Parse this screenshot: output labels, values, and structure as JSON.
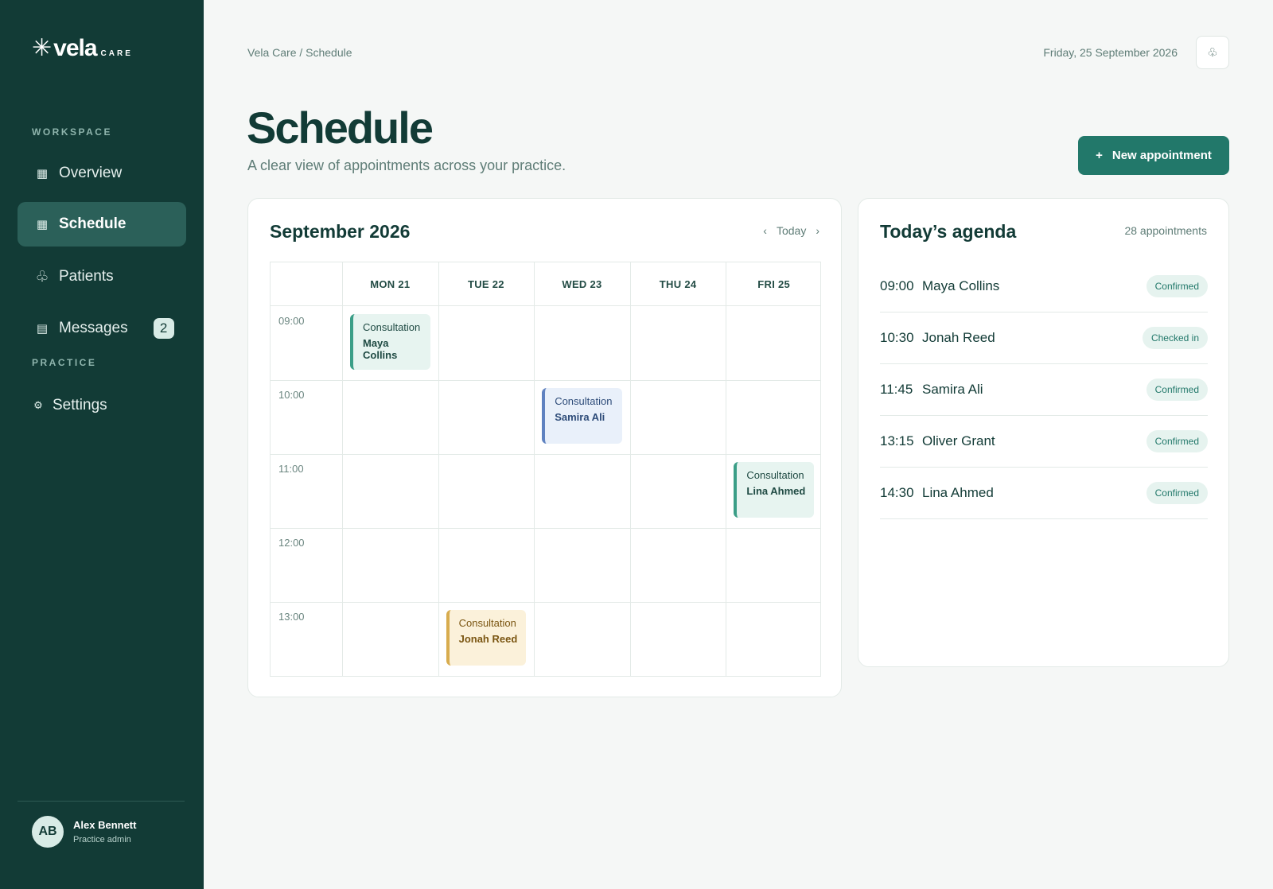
{
  "brand": {
    "mark": "✳",
    "name": "vela",
    "sub": "CARE"
  },
  "sidebar": {
    "workspace_label": "WORKSPACE",
    "practice_label": "PRACTICE",
    "items": [
      {
        "label": "Overview",
        "icon": "grid-icon",
        "glyph": "▦"
      },
      {
        "label": "Schedule",
        "icon": "calendar-icon",
        "glyph": "▦",
        "active": true
      },
      {
        "label": "Patients",
        "icon": "patients-icon",
        "glyph": "♧"
      },
      {
        "label": "Messages",
        "icon": "messages-icon",
        "glyph": "▤",
        "badge": "2"
      },
      {
        "label": "Settings",
        "icon": "gear-icon",
        "glyph": "⚙"
      }
    ],
    "user": {
      "initials": "AB",
      "name": "Alex Bennett",
      "role": "Practice admin"
    }
  },
  "header": {
    "breadcrumb": "Vela Care / Schedule",
    "date": "Friday, 25 September 2026",
    "icon": "notification-icon",
    "icon_glyph": "♧"
  },
  "page": {
    "title": "Schedule",
    "subtitle": "A clear view of appointments across your practice.",
    "new_button": {
      "plus": "+",
      "label": "New appointment"
    }
  },
  "calendar": {
    "title": "September 2026",
    "prev": "‹",
    "today": "Today",
    "next": "›",
    "days": [
      "MON 21",
      "TUE 22",
      "WED 23",
      "THU 24",
      "FRI 25"
    ],
    "times": [
      "09:00",
      "10:00",
      "11:00",
      "12:00",
      "13:00"
    ],
    "events": [
      {
        "type": "Consultation",
        "name": "Maya Collins",
        "day": 0,
        "slot": 0,
        "color": "green"
      },
      {
        "type": "Consultation",
        "name": "Samira Ali",
        "day": 2,
        "slot": 1,
        "color": "blue"
      },
      {
        "type": "Consultation",
        "name": "Lina Ahmed",
        "day": 4,
        "slot": 2,
        "color": "green"
      },
      {
        "type": "Consultation",
        "name": "Jonah Reed",
        "day": 1,
        "slot": 4,
        "color": "amber"
      }
    ]
  },
  "agenda": {
    "title": "Today’s agenda",
    "count": "28 appointments",
    "items": [
      {
        "time": "09:00",
        "name": "Maya Collins",
        "status": "Confirmed"
      },
      {
        "time": "10:30",
        "name": "Jonah Reed",
        "status": "Checked in"
      },
      {
        "time": "11:45",
        "name": "Samira Ali",
        "status": "Confirmed"
      },
      {
        "time": "13:15",
        "name": "Oliver Grant",
        "status": "Confirmed"
      },
      {
        "time": "14:30",
        "name": "Lina Ahmed",
        "status": "Confirmed"
      }
    ]
  },
  "colors": {
    "sidebar": "#123b36",
    "accent": "#22786a",
    "active_nav": "#2b6059"
  }
}
